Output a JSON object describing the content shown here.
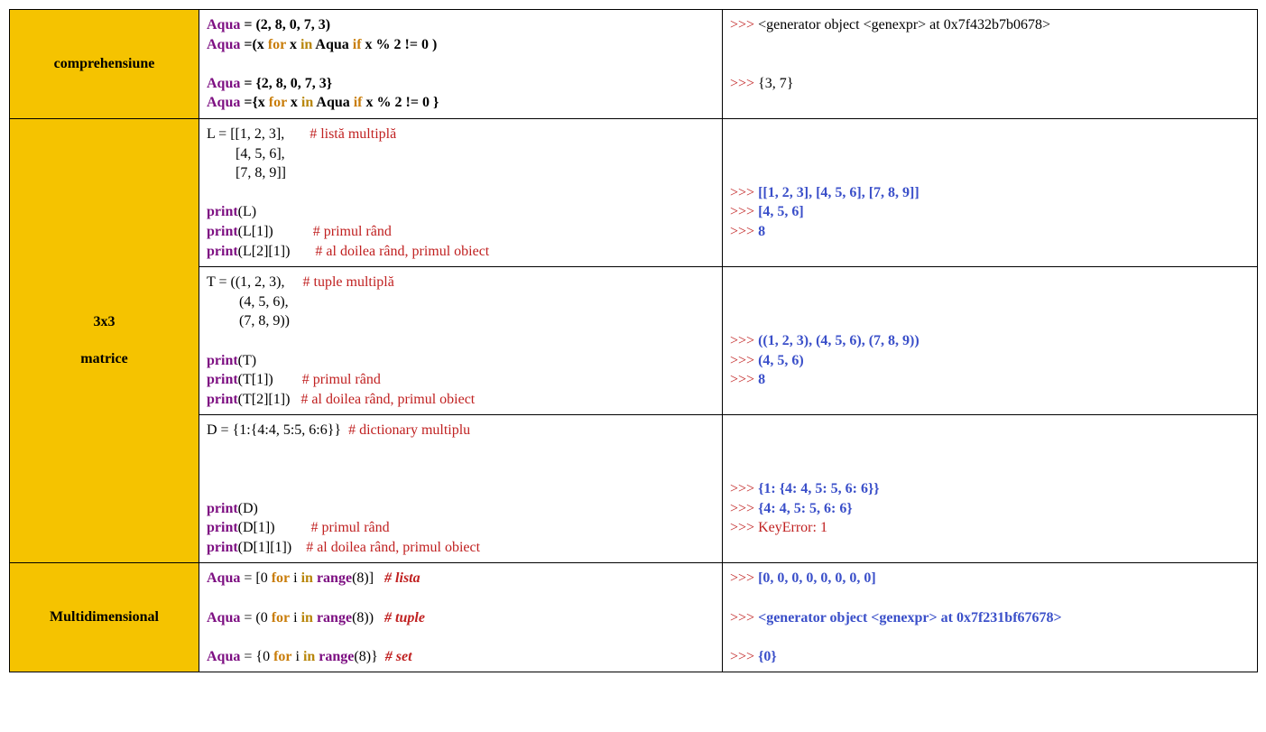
{
  "row1": {
    "hdr": "comprehensiune",
    "code": {
      "l1a": "Aqua",
      "l1b": " = (2, 8, 0, 7, 3)",
      "l2a": "Aqua",
      "l2b": " =(x ",
      "l2for": "for",
      "l2c": " x ",
      "l2in": "in",
      "l2d": " Aqua ",
      "l2if": "if",
      "l2e": " x % 2 != 0 )",
      "l3a": "Aqua",
      "l3b": " = {2, 8, 0, 7, 3}",
      "l4a": "Aqua",
      "l4b": " ={x ",
      "l4for": "for",
      "l4c": " x ",
      "l4in": "in",
      "l4d": " Aqua ",
      "l4if": "if",
      "l4e": " x % 2 != 0 }"
    },
    "out": {
      "p1": ">>> ",
      "o1": "<generator object <genexpr> at 0x7f432b7b0678>",
      "p2": ">>> ",
      "o2": "{3, 7}"
    }
  },
  "row2": {
    "hdr1": "3x3",
    "hdr2": "matrice",
    "list": {
      "l1": "L = [[1, 2, 3],       ",
      "c1": "# listă multiplă",
      "l2": "        [4, 5, 6],",
      "l3": "        [7, 8, 9]]",
      "p1a": "print",
      "p1b": "(L)",
      "p2a": "print",
      "p2b": "(L[1])           ",
      "c2": "# primul rând",
      "p3a": "print",
      "p3b": "(L[2][1])       ",
      "c3": "# al doilea rând, primul obiect"
    },
    "listout": {
      "p1": ">>> ",
      "o1": "[[1, 2, 3], [4, 5, 6], [7, 8, 9]]",
      "p2": ">>> ",
      "o2": "[4, 5, 6]",
      "p3": ">>> ",
      "o3": "8"
    },
    "tup": {
      "l1": "T = ((1, 2, 3),     ",
      "c1": "# tuple multiplă",
      "l2": "         (4, 5, 6),",
      "l3": "         (7, 8, 9))",
      "p1a": "print",
      "p1b": "(T)",
      "p2a": "print",
      "p2b": "(T[1])        ",
      "c2": "# primul rând",
      "p3a": "print",
      "p3b": "(T[2][1])   ",
      "c3": "# al doilea rând, primul obiect"
    },
    "tupout": {
      "p1": ">>> ",
      "o1": "((1, 2, 3), (4, 5, 6), (7, 8, 9))",
      "p2": ">>> ",
      "o2": "(4, 5, 6)",
      "p3": ">>> ",
      "o3": "8"
    },
    "dic": {
      "l1": "D = {1:{4:4, 5:5, 6:6}}  ",
      "c1": "# dictionary multiplu",
      "p1a": "print",
      "p1b": "(D)",
      "p2a": "print",
      "p2b": "(D[1])          ",
      "c2": "# primul rând",
      "p3a": "print",
      "p3b": "(D[1][1])    ",
      "c3": "# al doilea rând, primul obiect"
    },
    "dicout": {
      "p1": ">>> ",
      "o1": "{1: {4: 4, 5: 5, 6: 6}}",
      "p2": ">>> ",
      "o2": "{4: 4, 5: 5, 6: 6}",
      "p3": ">>> ",
      "o3": "KeyError: 1"
    }
  },
  "row3": {
    "hdr": "Multidimensional",
    "code": {
      "l1a": "Aqua",
      "l1b": " = [0 ",
      "l1for": "for",
      "l1c": " i ",
      "l1in": "in",
      "l1d": " ",
      "l1r": "range",
      "l1e": "(8)]   ",
      "l1cm": "# lista",
      "l2a": "Aqua",
      "l2b": " = (0 ",
      "l2for": "for",
      "l2c": " i ",
      "l2in": "in",
      "l2d": " ",
      "l2r": "range",
      "l2e": "(8))   ",
      "l2cm": "# tuple",
      "l3a": "Aqua",
      "l3b": " = {0 ",
      "l3for": "for",
      "l3c": " i ",
      "l3in": "in",
      "l3d": " ",
      "l3r": "range",
      "l3e": "(8)}  ",
      "l3cm": "# set"
    },
    "out": {
      "p1": ">>> ",
      "o1": "[0, 0, 0, 0, 0, 0, 0, 0]",
      "p2": ">>> ",
      "o2": "<generator object <genexpr> at 0x7f231bf67678>",
      "p3": ">>> ",
      "o3": "{0}"
    }
  }
}
